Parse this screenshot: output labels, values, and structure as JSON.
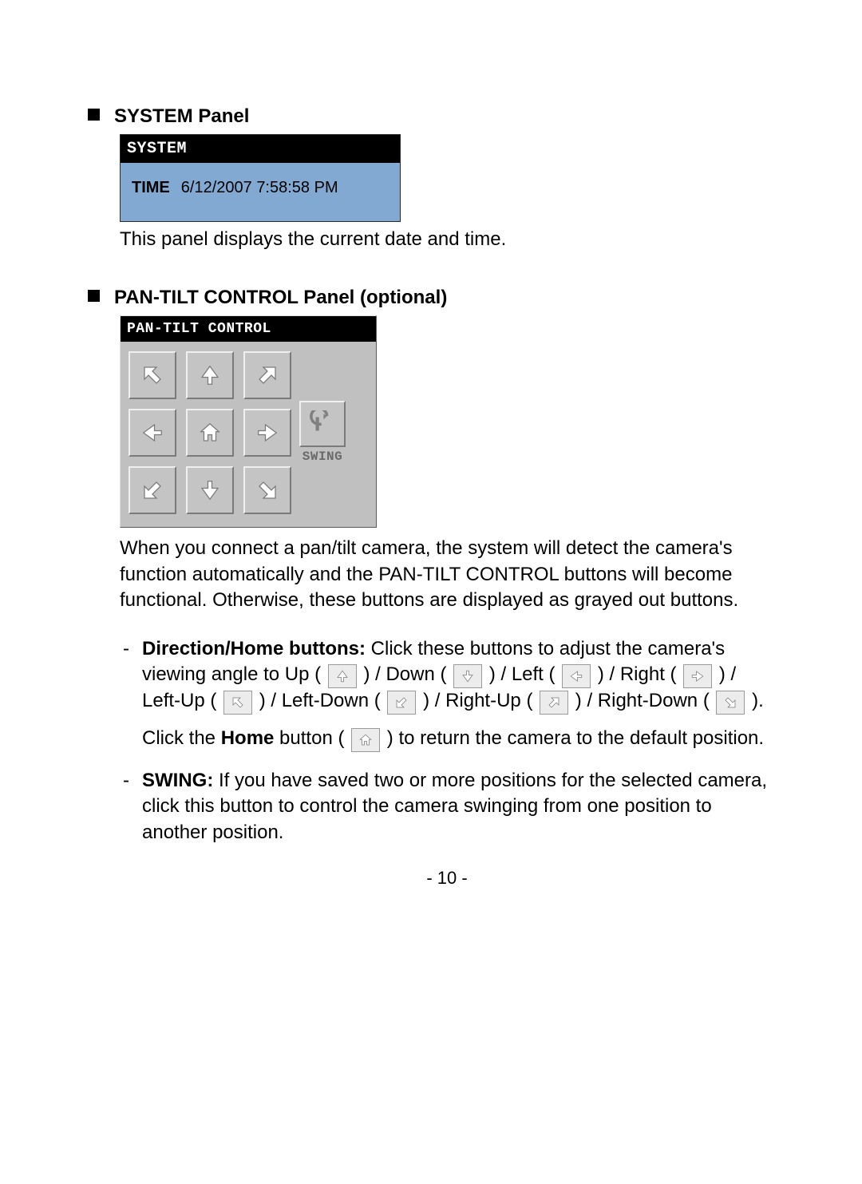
{
  "sections": {
    "system": {
      "heading": "SYSTEM Panel",
      "panel_header": "SYSTEM",
      "time_label": "TIME",
      "time_value": "6/12/2007 7:58:58 PM",
      "caption": "This panel displays the current date and time."
    },
    "pantilt": {
      "heading": "PAN-TILT CONTROL Panel (optional)",
      "panel_header": "PAN-TILT CONTROL",
      "swing_label": "SWING",
      "intro": "When you connect a pan/tilt camera, the system will detect the camera's function automatically and the PAN-TILT CONTROL buttons will become functional. Otherwise, these buttons are displayed as grayed out buttons.",
      "dir_label": "Direction/Home buttons:",
      "dir_text_1": " Click these buttons to adjust the camera's viewing angle to Up ( ",
      "dir_text_2": " ) / Down ( ",
      "dir_text_3": " ) / Left ( ",
      "dir_text_4": " ) / Right ( ",
      "dir_text_5": " ) / Left-Up ( ",
      "dir_text_6": " ) / Left-Down ( ",
      "dir_text_7": " ) / Right-Up ( ",
      "dir_text_8": " ) / Right-Down ( ",
      "dir_text_9": " ).",
      "home_pre": "Click the ",
      "home_bold": "Home",
      "home_mid": " button ( ",
      "home_post": " ) to return the camera to the default position.",
      "swing_bold": "SWING:",
      "swing_text": " If you have saved two or more positions for the selected camera, click this button to control the camera swinging from one position to another position."
    }
  },
  "page_number": "- 10 -"
}
